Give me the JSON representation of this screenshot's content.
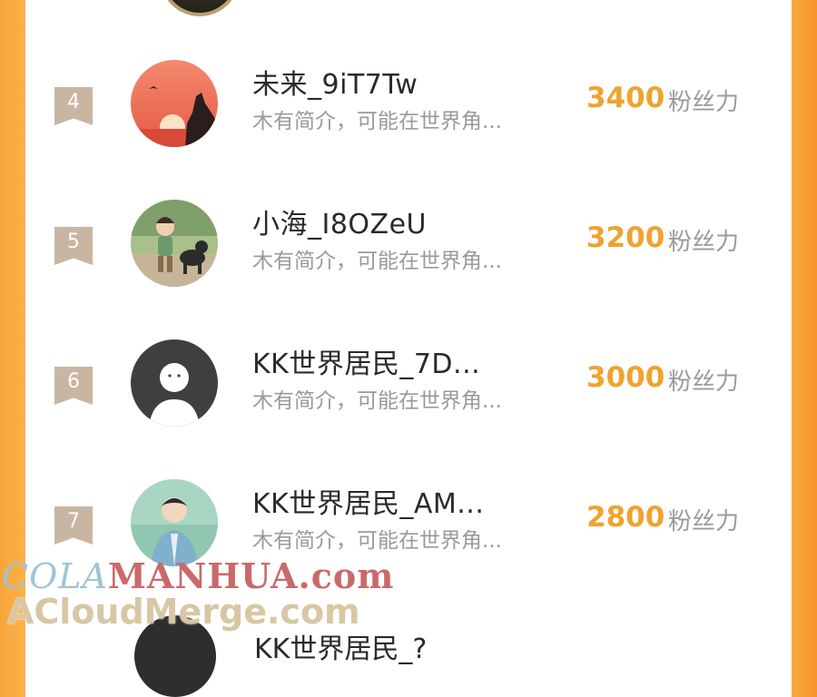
{
  "rankings": [
    {
      "rank": "4",
      "name": "未来_9iT7Tw",
      "bio": "木有简介，可能在世界角...",
      "score": "3400",
      "unit": "粉丝力"
    },
    {
      "rank": "5",
      "name": "小海_I8OZeU",
      "bio": "木有简介，可能在世界角...",
      "score": "3200",
      "unit": "粉丝力"
    },
    {
      "rank": "6",
      "name": "KK世界居民_7D...",
      "bio": "木有简介，可能在世界角...",
      "score": "3000",
      "unit": "粉丝力"
    },
    {
      "rank": "7",
      "name": "KK世界居民_AM...",
      "bio": "木有简介，可能在世界角...",
      "score": "2800",
      "unit": "粉丝力"
    }
  ],
  "partial_next": {
    "name": "KK世界居民_?"
  },
  "watermark": {
    "line1_a": "COLA",
    "line1_b": "MANHUA.com",
    "line2": "ACloudMerge.com"
  },
  "colors": {
    "accent": "#efa32f",
    "rank_badge": "#c8b6a3",
    "frame_orange": "#f7a53a"
  }
}
